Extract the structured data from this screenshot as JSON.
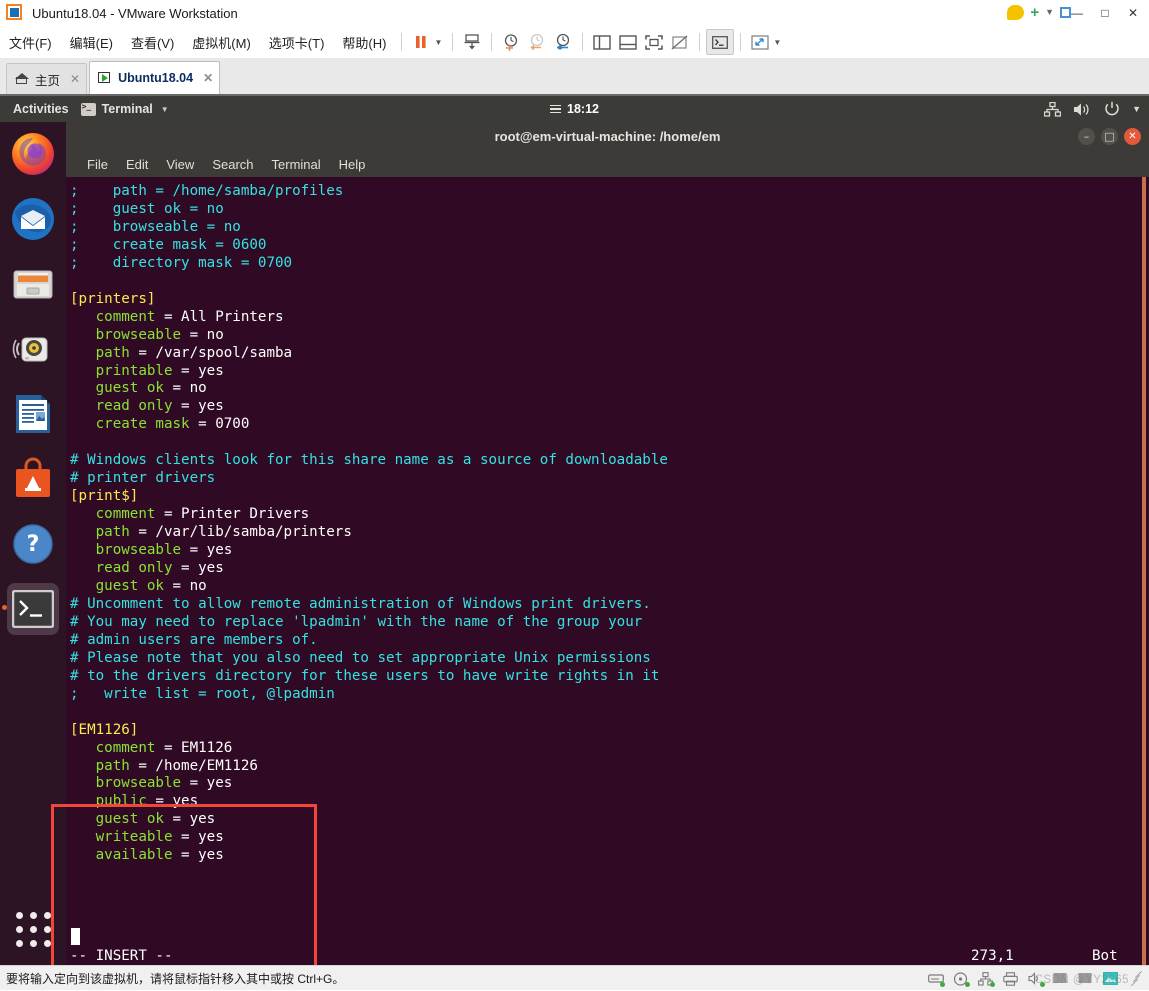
{
  "vmware": {
    "title": "Ubuntu18.04 - VMware Workstation",
    "logo_icon": "vmware-logo-icon",
    "window_buttons": [
      {
        "name": "minimize-button",
        "glyph": "—"
      },
      {
        "name": "maximize-button",
        "glyph": "□"
      },
      {
        "name": "close-button",
        "glyph": "✕"
      }
    ],
    "menus": [
      {
        "name": "menu-file",
        "label": "文件(F)"
      },
      {
        "name": "menu-edit",
        "label": "编辑(E)"
      },
      {
        "name": "menu-view",
        "label": "查看(V)"
      },
      {
        "name": "menu-vm",
        "label": "虚拟机(M)"
      },
      {
        "name": "menu-tabs",
        "label": "选项卡(T)"
      },
      {
        "name": "menu-help",
        "label": "帮助(H)"
      }
    ],
    "toolbar": [
      {
        "name": "suspend-button",
        "icon": "pause-icon"
      },
      {
        "name": "power-dropdown",
        "icon": "chevron-down-icon"
      },
      {
        "name": "manage-snapshot-button",
        "icon": "snapshot-manage-icon"
      },
      {
        "name": "take-snapshot-button",
        "icon": "snapshot-take-icon"
      },
      {
        "name": "revert-snapshot-button",
        "icon": "snapshot-revert-icon"
      },
      {
        "name": "snapshot-manager-button",
        "icon": "snapshot-manager-icon"
      },
      {
        "name": "show-library-button",
        "icon": "sidebar-panel-icon"
      },
      {
        "name": "show-thumbnail-bar-button",
        "icon": "bottom-panel-icon"
      },
      {
        "name": "fullscreen-button",
        "icon": "fullscreen-icon"
      },
      {
        "name": "unity-mode-button",
        "icon": "unity-mode-icon"
      },
      {
        "name": "console-view-button",
        "icon": "console-icon"
      },
      {
        "name": "stretch-guest-button",
        "icon": "expand-arrows-icon"
      },
      {
        "name": "stretch-dropdown",
        "icon": "chevron-down-icon"
      }
    ],
    "tabs": [
      {
        "name": "tab-home",
        "label": "主页",
        "icon": "home-icon",
        "active": false
      },
      {
        "name": "tab-ubuntu",
        "label": "Ubuntu18.04",
        "icon": "vm-running-icon",
        "active": true
      }
    ],
    "status_hint": "要将输入定向到该虚拟机，请将鼠标指针移入其中或按 Ctrl+G。",
    "status_icons": [
      {
        "name": "harddisk-status-icon"
      },
      {
        "name": "cdrom-status-icon"
      },
      {
        "name": "network-status-icon"
      },
      {
        "name": "printer-status-icon"
      },
      {
        "name": "sound-status-icon"
      },
      {
        "name": "usb-status-icon"
      },
      {
        "name": "keyboard-status-icon"
      },
      {
        "name": "display-status-icon"
      }
    ],
    "watermark": "CSDN @YY2065"
  },
  "ubuntu": {
    "topbar": {
      "activities_label": "Activities",
      "app_menu_label": "Terminal",
      "clock": "18:12",
      "status_icons": [
        {
          "name": "network-icon"
        },
        {
          "name": "volume-icon"
        },
        {
          "name": "power-icon"
        },
        {
          "name": "chevron-down-icon"
        }
      ]
    },
    "dock": [
      {
        "name": "dock-item-firefox",
        "label": "Firefox"
      },
      {
        "name": "dock-item-thunderbird",
        "label": "Thunderbird Mail"
      },
      {
        "name": "dock-item-files",
        "label": "Files"
      },
      {
        "name": "dock-item-rhythmbox",
        "label": "Rhythmbox"
      },
      {
        "name": "dock-item-libreoffice-writer",
        "label": "LibreOffice Writer"
      },
      {
        "name": "dock-item-ubuntu-software",
        "label": "Ubuntu Software"
      },
      {
        "name": "dock-item-help",
        "label": "Help"
      },
      {
        "name": "dock-item-terminal",
        "label": "Terminal"
      }
    ],
    "show_applications_label": "Show Applications"
  },
  "terminal": {
    "title": "root@em-virtual-machine: /home/em",
    "window_buttons": [
      {
        "name": "terminal-minimize-button",
        "glyph": "–"
      },
      {
        "name": "terminal-maximize-button",
        "glyph": "□"
      },
      {
        "name": "terminal-close-button",
        "glyph": "✕"
      }
    ],
    "menus": [
      {
        "name": "terminal-menu-file",
        "label": "File"
      },
      {
        "name": "terminal-menu-edit",
        "label": "Edit"
      },
      {
        "name": "terminal-menu-view",
        "label": "View"
      },
      {
        "name": "terminal-menu-search",
        "label": "Search"
      },
      {
        "name": "terminal-menu-terminal",
        "label": "Terminal"
      },
      {
        "name": "terminal-menu-help",
        "label": "Help"
      }
    ],
    "colors": {
      "background": "#300a24",
      "comment": "#34e2e2",
      "section": "#fce94f",
      "key": "#8ae234",
      "value": "#ad7fa8",
      "plain": "#ffffff",
      "annotation_box": "#f3453a"
    },
    "lines": [
      [
        {
          "t": ";",
          "c": "comment"
        },
        {
          "t": "    path = /home/samba/profiles",
          "c": "comment"
        }
      ],
      [
        {
          "t": ";    guest ok = no",
          "c": "comment"
        }
      ],
      [
        {
          "t": ";    browseable = no",
          "c": "comment"
        }
      ],
      [
        {
          "t": ";    create mask = 0600",
          "c": "comment"
        }
      ],
      [
        {
          "t": ";    directory mask = 0700",
          "c": "comment"
        }
      ],
      [],
      [
        {
          "t": "[printers]",
          "c": "section"
        }
      ],
      [
        {
          "t": "   comment",
          "c": "key"
        },
        {
          "t": " = All Printers",
          "c": "plain"
        }
      ],
      [
        {
          "t": "   browseable",
          "c": "key"
        },
        {
          "t": " = ",
          "c": "plain"
        },
        {
          "t": "no",
          "c": "value"
        }
      ],
      [
        {
          "t": "   path",
          "c": "key"
        },
        {
          "t": " = /var/spool/samba",
          "c": "plain"
        }
      ],
      [
        {
          "t": "   printable",
          "c": "key"
        },
        {
          "t": " = ",
          "c": "plain"
        },
        {
          "t": "yes",
          "c": "value"
        }
      ],
      [
        {
          "t": "   guest ok",
          "c": "key"
        },
        {
          "t": " = ",
          "c": "plain"
        },
        {
          "t": "no",
          "c": "value"
        }
      ],
      [
        {
          "t": "   read only",
          "c": "key"
        },
        {
          "t": " = ",
          "c": "plain"
        },
        {
          "t": "yes",
          "c": "value"
        }
      ],
      [
        {
          "t": "   create mask",
          "c": "key"
        },
        {
          "t": " = 0700",
          "c": "plain"
        }
      ],
      [],
      [
        {
          "t": "# Windows clients look for this share name as a source of downloadable",
          "c": "comment"
        }
      ],
      [
        {
          "t": "# printer drivers",
          "c": "comment"
        }
      ],
      [
        {
          "t": "[print$]",
          "c": "section"
        }
      ],
      [
        {
          "t": "   comment",
          "c": "key"
        },
        {
          "t": " = Printer Drivers",
          "c": "plain"
        }
      ],
      [
        {
          "t": "   path",
          "c": "key"
        },
        {
          "t": " = /var/lib/samba/printers",
          "c": "plain"
        }
      ],
      [
        {
          "t": "   browseable",
          "c": "key"
        },
        {
          "t": " = ",
          "c": "plain"
        },
        {
          "t": "yes",
          "c": "value"
        }
      ],
      [
        {
          "t": "   read only",
          "c": "key"
        },
        {
          "t": " = ",
          "c": "plain"
        },
        {
          "t": "yes",
          "c": "value"
        }
      ],
      [
        {
          "t": "   guest ok",
          "c": "key"
        },
        {
          "t": " = ",
          "c": "plain"
        },
        {
          "t": "no",
          "c": "value"
        }
      ],
      [
        {
          "t": "# Uncomment to allow remote administration of Windows print drivers.",
          "c": "comment"
        }
      ],
      [
        {
          "t": "# You may need to replace 'lpadmin' with the name of the group your",
          "c": "comment"
        }
      ],
      [
        {
          "t": "# admin users are members of.",
          "c": "comment"
        }
      ],
      [
        {
          "t": "# Please note that you also need to set appropriate Unix permissions",
          "c": "comment"
        }
      ],
      [
        {
          "t": "# to the drivers directory for these users to have write rights in it",
          "c": "comment"
        }
      ],
      [
        {
          "t": ";   write list = root, @lpadmin",
          "c": "comment"
        }
      ],
      [],
      [
        {
          "t": "[EM1126]",
          "c": "section"
        }
      ],
      [
        {
          "t": "   comment",
          "c": "key"
        },
        {
          "t": " = EM1126",
          "c": "plain"
        }
      ],
      [
        {
          "t": "   path",
          "c": "key"
        },
        {
          "t": " = /home/EM1126",
          "c": "plain"
        }
      ],
      [
        {
          "t": "   browseable",
          "c": "key"
        },
        {
          "t": " = ",
          "c": "plain"
        },
        {
          "t": "yes",
          "c": "value"
        }
      ],
      [
        {
          "t": "   public",
          "c": "key"
        },
        {
          "t": " = ",
          "c": "plain"
        },
        {
          "t": "yes",
          "c": "value"
        }
      ],
      [
        {
          "t": "   guest ok",
          "c": "key"
        },
        {
          "t": " = ",
          "c": "plain"
        },
        {
          "t": "yes",
          "c": "value"
        }
      ],
      [
        {
          "t": "   writeable",
          "c": "key"
        },
        {
          "t": " = ",
          "c": "plain"
        },
        {
          "t": "yes",
          "c": "value"
        }
      ],
      [
        {
          "t": "   available",
          "c": "key"
        },
        {
          "t": " = ",
          "c": "plain"
        },
        {
          "t": "yes",
          "c": "value"
        }
      ]
    ],
    "vim_status": {
      "mode": "-- INSERT --",
      "position": "273,1",
      "location": "Bot"
    }
  }
}
